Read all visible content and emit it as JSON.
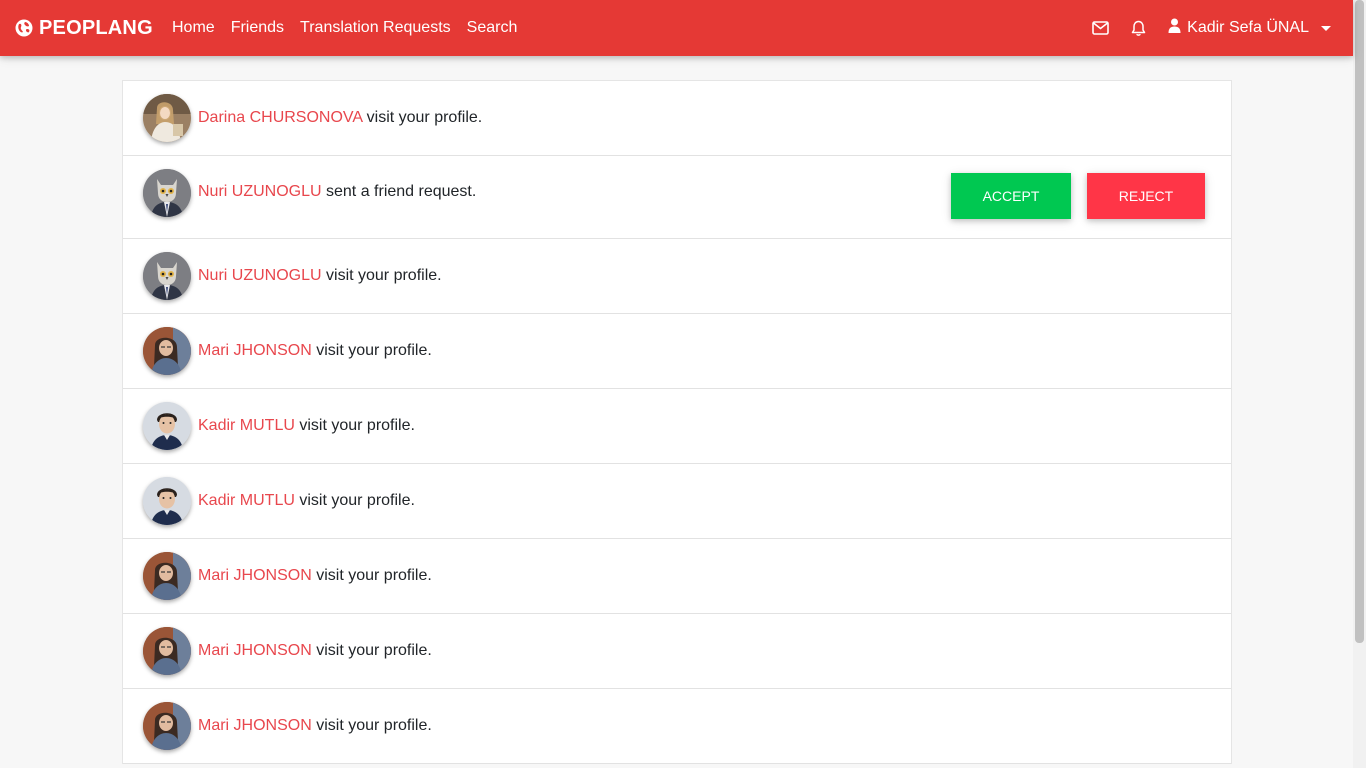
{
  "brand": {
    "name": "PEOPLANG",
    "icon": "globe-icon"
  },
  "nav": {
    "links": [
      "Home",
      "Friends",
      "Translation Requests",
      "Search"
    ],
    "user_name": "Kadir Sefa ÜNAL",
    "icons": [
      "envelope-icon",
      "bell-icon",
      "user-icon"
    ]
  },
  "colors": {
    "navbar": "#e53935",
    "name_link": "#e8474d",
    "accept": "#00c851",
    "reject": "#ff3547"
  },
  "actions": {
    "accept": "ACCEPT",
    "reject": "REJECT"
  },
  "notifications": [
    {
      "name": "Darina CHURSONOVA",
      "text": " visit your profile.",
      "avatar": "darina"
    },
    {
      "name": "Nuri UZUNOGLU",
      "text": " sent a friend request.",
      "avatar": "nuri",
      "friend_request": true
    },
    {
      "name": "Nuri UZUNOGLU",
      "text": " visit your profile.",
      "avatar": "nuri"
    },
    {
      "name": "Mari JHONSON",
      "text": " visit your profile.",
      "avatar": "mari"
    },
    {
      "name": "Kadir MUTLU",
      "text": " visit your profile.",
      "avatar": "kadir"
    },
    {
      "name": "Kadir MUTLU",
      "text": " visit your profile.",
      "avatar": "kadir"
    },
    {
      "name": "Mari JHONSON",
      "text": " visit your profile.",
      "avatar": "mari"
    },
    {
      "name": "Mari JHONSON",
      "text": " visit your profile.",
      "avatar": "mari"
    },
    {
      "name": "Mari JHONSON",
      "text": " visit your profile.",
      "avatar": "mari"
    }
  ]
}
